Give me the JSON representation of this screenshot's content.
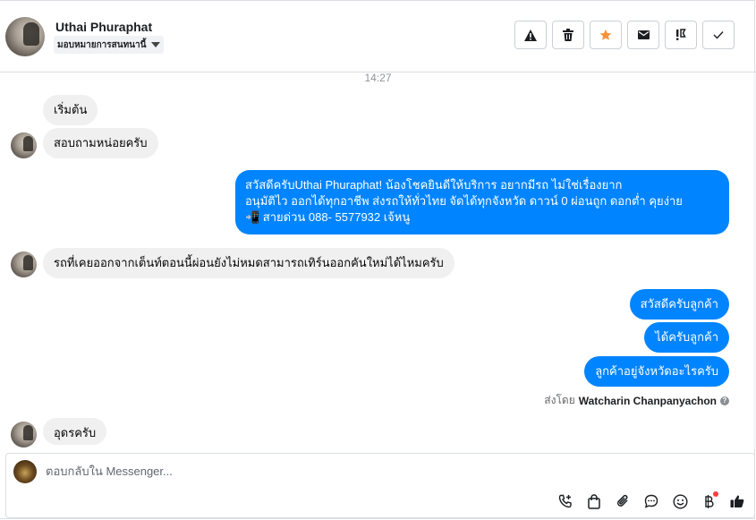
{
  "header": {
    "contact_name": "Uthai Phuraphat",
    "assign_label": "มอบหมายการสนทนานี้",
    "actions": [
      {
        "name": "warning-icon"
      },
      {
        "name": "trash-icon"
      },
      {
        "name": "star-icon",
        "color": "#f7923b"
      },
      {
        "name": "envelope-icon"
      },
      {
        "name": "follow-up-icon"
      },
      {
        "name": "check-icon"
      }
    ]
  },
  "thread": {
    "timestamp": "14:27",
    "messages": [
      {
        "direction": "in",
        "text": "เริ่มต้น"
      },
      {
        "direction": "in",
        "text": "สอบถามหน่อยครับ"
      },
      {
        "direction": "out",
        "lines": [
          "สวัสดีครับUthai Phuraphat! น้องโชคยินดีให้บริการ อยากมีรถ ไม่ใช่เรื่องยาก",
          "อนุมัติไว ออกได้ทุกอาชีพ ส่งรถให้ทั่วไทย จัดได้ทุกจังหวัด ดาวน์ 0  ผ่อนถูก ดอกต่ำ คุยง่าย",
          "📲 สายด่วน 088- 5577932 เจ้หนู"
        ]
      },
      {
        "direction": "in",
        "text": "รถที่เคยออกจากเต็นท์ตอนนี้ผ่อนยังไม่หมดสามารถเทิร์นออกคันใหม่ได้ไหมครับ"
      },
      {
        "direction": "out",
        "text": "สวัสดีครับลูกค้า"
      },
      {
        "direction": "out",
        "text": "ได้ครับลูกค้า"
      },
      {
        "direction": "out",
        "text": "ลูกค้าอยู่จังหวัดอะไรครับ"
      },
      {
        "direction": "in",
        "text": "อุดรครับ"
      }
    ],
    "sent_by_label": "ส่งโดย",
    "sent_by_name": "Watcharin Chanpanyachon"
  },
  "composer": {
    "placeholder": "ตอบกลับใน Messenger...",
    "tools": [
      "phone-plus-icon",
      "shopping-bag-icon",
      "attachment-icon",
      "chat-bubble-icon",
      "emoji-icon",
      "baht-icon",
      "thumbs-up-icon"
    ]
  },
  "colors": {
    "outgoing_bubble": "#0084ff",
    "incoming_bubble": "#f0f0f0",
    "star": "#f7923b"
  }
}
